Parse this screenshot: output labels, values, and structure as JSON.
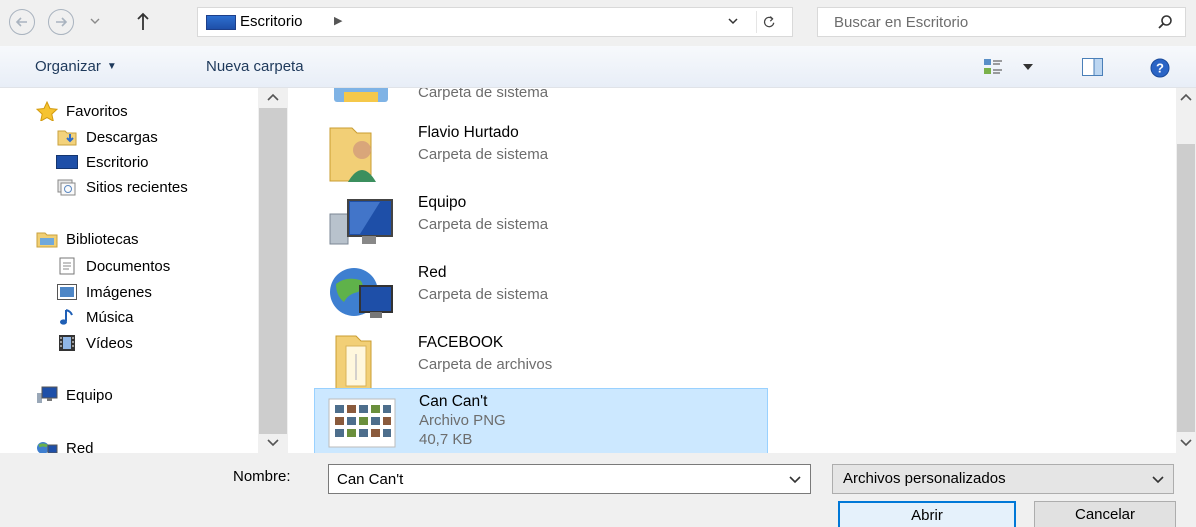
{
  "address": {
    "location": "Escritorio",
    "search_placeholder": "Buscar en Escritorio"
  },
  "toolbar": {
    "organize_label": "Organizar",
    "new_folder_label": "Nueva carpeta"
  },
  "nav": {
    "favorites": "Favoritos",
    "downloads": "Descargas",
    "desktop": "Escritorio",
    "recent": "Sitios recientes",
    "libraries": "Bibliotecas",
    "documents": "Documentos",
    "pictures": "Imágenes",
    "music": "Música",
    "videos": "Vídeos",
    "computer": "Equipo",
    "network": "Red"
  },
  "files": [
    {
      "name": "",
      "type": "Carpeta de sistema"
    },
    {
      "name": "Flavio Hurtado",
      "type": "Carpeta de sistema"
    },
    {
      "name": "Equipo",
      "type": "Carpeta de sistema"
    },
    {
      "name": "Red",
      "type": "Carpeta de sistema"
    },
    {
      "name": "FACEBOOK",
      "type": "Carpeta de archivos"
    },
    {
      "name": "Can Can't",
      "type": "Archivo PNG",
      "size": "40,7 KB"
    }
  ],
  "bottom": {
    "name_label": "Nombre:",
    "name_value": "Can Can't",
    "filter_value": "Archivos personalizados",
    "open_label": "Abrir",
    "cancel_label": "Cancelar"
  }
}
